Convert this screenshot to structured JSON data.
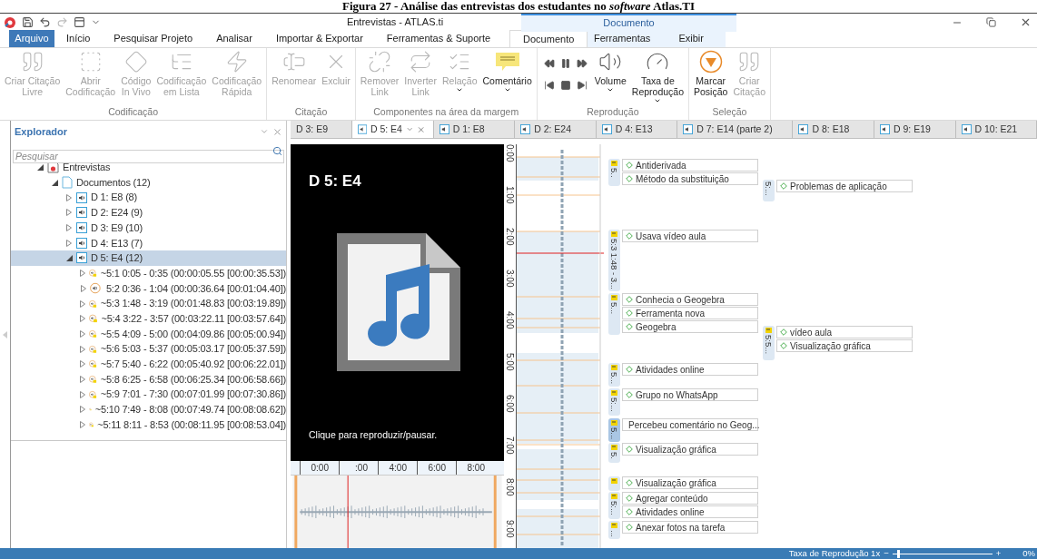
{
  "caption": "Figura 27 - Análise das entrevistas dos estudantes no *software* Atlas.TI",
  "window": {
    "title": "Entrevistas - ATLAS.ti",
    "context_label": "Documento"
  },
  "ribbon_tabs": [
    {
      "label": "Arquivo",
      "kind": "file",
      "selected": false
    },
    {
      "label": "Início",
      "kind": "tab",
      "selected": false
    },
    {
      "label": "Pesquisar Projeto",
      "kind": "tab",
      "selected": false
    },
    {
      "label": "Analisar",
      "kind": "tab",
      "selected": false
    },
    {
      "label": "Importar & Exportar",
      "kind": "tab",
      "selected": false
    },
    {
      "label": "Ferramentas & Suporte",
      "kind": "tab",
      "selected": false
    },
    {
      "label": "Documento",
      "kind": "context",
      "selected": true
    },
    {
      "label": "Ferramentas",
      "kind": "context",
      "selected": false
    },
    {
      "label": "Exibir",
      "kind": "context",
      "selected": false
    }
  ],
  "ribbon_groups": [
    {
      "label": "Codificação",
      "buttons": [
        {
          "label": "Criar Citação\nLivre",
          "disabled": true,
          "dropdown": false
        },
        {
          "label": "Abrir\nCodificação",
          "disabled": true,
          "dropdown": false
        },
        {
          "label": "Código\nIn Vivo",
          "disabled": true,
          "dropdown": false
        },
        {
          "label": "Codificação\nem Lista",
          "disabled": true,
          "dropdown": false
        },
        {
          "label": "Codificação\nRápida",
          "disabled": true,
          "dropdown": false
        }
      ]
    },
    {
      "label": "Citação",
      "buttons": [
        {
          "label": "Renomear",
          "disabled": true,
          "dropdown": false
        },
        {
          "label": "Excluir",
          "disabled": true,
          "dropdown": false
        }
      ]
    },
    {
      "label": "Componentes na área da margem",
      "buttons": [
        {
          "label": "Remover\nLink",
          "disabled": true,
          "dropdown": false
        },
        {
          "label": "Inverter\nLink",
          "disabled": true,
          "dropdown": false
        },
        {
          "label": "Relação",
          "disabled": true,
          "dropdown": true
        },
        {
          "label": "Comentário",
          "disabled": false,
          "dropdown": true
        }
      ]
    },
    {
      "label": "Reprodução",
      "buttons": [
        {
          "label": "Volume",
          "disabled": false,
          "dropdown": true
        },
        {
          "label": "Taxa de\nReprodução",
          "disabled": false,
          "dropdown": true
        }
      ]
    },
    {
      "label": "Seleção",
      "buttons": [
        {
          "label": "Marcar\nPosição",
          "disabled": false,
          "dropdown": false
        },
        {
          "label": "Criar\nCitação",
          "disabled": true,
          "dropdown": false
        }
      ]
    }
  ],
  "explorer": {
    "title": "Explorador",
    "search": {
      "placeholder": "Pesquisar"
    },
    "tree": [
      {
        "label": "Entrevistas",
        "kind": "project",
        "expanded": true,
        "selected": false,
        "children": [
          {
            "label": "Documentos (12)",
            "kind": "folder",
            "expanded": true,
            "selected": false,
            "children": [
              {
                "label": "D 1: E8 (8)",
                "kind": "document",
                "expanded": false,
                "selected": false
              },
              {
                "label": "D 2: E24 (9)",
                "kind": "document",
                "expanded": false,
                "selected": false
              },
              {
                "label": "D 3: E9 (10)",
                "kind": "document",
                "expanded": false,
                "selected": false
              },
              {
                "label": "D 4: E13 (7)",
                "kind": "document",
                "expanded": false,
                "selected": false
              },
              {
                "label": "D 5: E4 (12)",
                "kind": "document",
                "expanded": true,
                "selected": true,
                "children": [
                  {
                    "label": "~5:1 0:05 - 0:35 (00:00:05.55 [00:00:35.53])",
                    "kind": "quote",
                    "comment": true,
                    "expanded": false,
                    "selected": false
                  },
                  {
                    "label": "5:2 0:36 - 1:04 (00:00:36.64 [00:01:04.40])",
                    "kind": "quote",
                    "comment": false,
                    "expanded": false,
                    "selected": false
                  },
                  {
                    "label": "~5:3 1:48 - 3:19 (00:01:48.83 [00:03:19.89])",
                    "kind": "quote",
                    "comment": true,
                    "expanded": false,
                    "selected": false
                  },
                  {
                    "label": "~5:4 3:22 - 3:57 (00:03:22.11 [00:03:57.64])",
                    "kind": "quote",
                    "comment": true,
                    "expanded": false,
                    "selected": false
                  },
                  {
                    "label": "~5:5 4:09 - 5:00 (00:04:09.86 [00:05:00.94])",
                    "kind": "quote",
                    "comment": true,
                    "expanded": false,
                    "selected": false
                  },
                  {
                    "label": "~5:6 5:03 - 5:37 (00:05:03.17 [00:05:37.59])",
                    "kind": "quote",
                    "comment": true,
                    "expanded": false,
                    "selected": false
                  },
                  {
                    "label": "~5:7 5:40 - 6:22 (00:05:40.92 [00:06:22.01])",
                    "kind": "quote",
                    "comment": true,
                    "expanded": false,
                    "selected": false
                  },
                  {
                    "label": "~5:8 6:25 - 6:58 (00:06:25.34 [00:06:58.66])",
                    "kind": "quote",
                    "comment": true,
                    "expanded": false,
                    "selected": false
                  },
                  {
                    "label": "~5:9 7:01 - 7:30 (00:07:01.99 [00:07:30.86])",
                    "kind": "quote",
                    "comment": true,
                    "expanded": false,
                    "selected": false
                  },
                  {
                    "label": "~5:10 7:49 - 8:08 (00:07:49.74 [00:08:08.62])",
                    "kind": "quote",
                    "comment": true,
                    "expanded": false,
                    "selected": false
                  },
                  {
                    "label": "~5:11 8:11 - 8:53 (00:08:11.95 [00:08:53.04])",
                    "kind": "quote",
                    "comment": true,
                    "expanded": false,
                    "selected": false
                  }
                ]
              }
            ]
          }
        ]
      }
    ]
  },
  "doc_tabs": [
    {
      "label": "D 3: E9",
      "selected": false,
      "icon": false
    },
    {
      "label": "D 5: E4",
      "selected": true,
      "icon": true
    },
    {
      "label": "D 1: E8",
      "selected": false,
      "icon": true
    },
    {
      "label": "D 2: E24",
      "selected": false,
      "icon": true
    },
    {
      "label": "D 4: E13",
      "selected": false,
      "icon": true
    },
    {
      "label": "D 7: E14 (parte 2)",
      "selected": false,
      "icon": true
    },
    {
      "label": "D 8: E18",
      "selected": false,
      "icon": true
    },
    {
      "label": "D 9: E19",
      "selected": false,
      "icon": true
    },
    {
      "label": "D 10: E21",
      "selected": false,
      "icon": true
    }
  ],
  "player": {
    "title": "D 5: E4",
    "hint": "Clique para reproduzir/pausar.",
    "ruler": [
      "0:00",
      ":00",
      "4:00",
      "6:00",
      "8:00"
    ]
  },
  "vertical_ruler": [
    "0:00",
    "1:00",
    "2:00",
    "3:00",
    "4:00",
    "5:00",
    "6:00",
    "7:00",
    "8:00",
    "9:00"
  ],
  "quotations": [
    {
      "label": "5..",
      "comment": true,
      "selected": false,
      "codes": [
        "Antiderivada",
        "Método da substituição"
      ]
    },
    {
      "label": "5:3 1:48 - 3...",
      "comment": true,
      "selected": false,
      "codes": [
        "Usava vídeo aula"
      ]
    },
    {
      "label": "5...",
      "comment": true,
      "selected": false,
      "codes": [
        "Conhecia o Geogebra",
        "Ferramenta nova",
        "Geogebra"
      ]
    },
    {
      "label": "5...",
      "comment": true,
      "selected": false,
      "codes": [
        "Atividades online"
      ]
    },
    {
      "label": "5:...",
      "comment": true,
      "selected": false,
      "codes": [
        "Grupo no WhatsApp"
      ]
    },
    {
      "label": "5...",
      "comment": true,
      "selected": true,
      "codes": [
        "Percebeu comentário no Geog..."
      ]
    },
    {
      "label": "5.",
      "comment": true,
      "selected": false,
      "codes": [
        "Visualização gráfica"
      ]
    },
    {
      "comment": true,
      "selected": false,
      "codes": [
        "Visualização gráfica"
      ]
    },
    {
      "label": "5:...",
      "comment": true,
      "selected": false,
      "codes": [
        "Agregar conteúdo",
        "Atividades online"
      ]
    },
    {
      "label": "...",
      "comment": true,
      "selected": false,
      "codes": [
        "Anexar fotos na tarefa"
      ]
    },
    {
      "label": "5:...",
      "comment": false,
      "selected": false,
      "codes": [
        "Problemas de aplicação"
      ]
    },
    {
      "label": "5:5...",
      "comment": true,
      "selected": false,
      "codes": [
        "vídeo aula",
        "Visualização gráfica"
      ]
    }
  ],
  "status_bar": {
    "label": "Taxa de Reprodução 1x",
    "minus": "−",
    "plus": "+",
    "zoom": "0%",
    "slider": {
      "level": 0.05
    }
  }
}
